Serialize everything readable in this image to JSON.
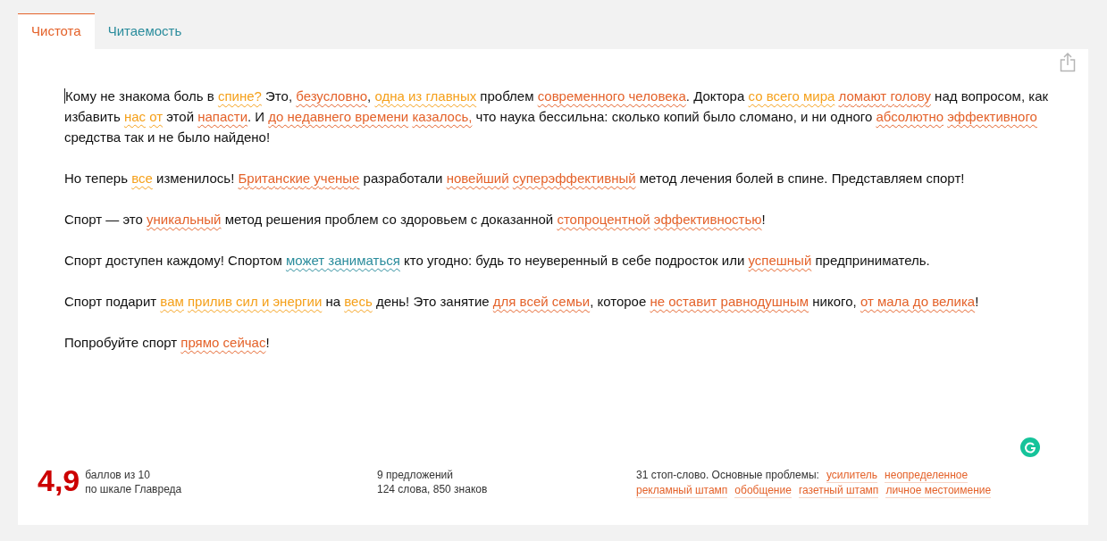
{
  "tabs": [
    {
      "label": "Чистота",
      "selected": true
    },
    {
      "label": "Читаемость",
      "selected": false
    }
  ],
  "editor": {
    "paragraphs": [
      [
        {
          "text": "Кому не знакома боль в "
        },
        {
          "text": "спине?",
          "color": "#f5a01a"
        },
        {
          "text": " Это, "
        },
        {
          "text": "безусловно",
          "color": "#e4622a"
        },
        {
          "text": ", "
        },
        {
          "text": "одна из главных",
          "color": "#f5a01a"
        },
        {
          "text": " проблем "
        },
        {
          "text": "современного человека",
          "color": "#e4622a"
        },
        {
          "text": ". Доктора "
        },
        {
          "text": "со всего мира",
          "color": "#f5a01a",
          "space_after": true
        },
        {
          "text": "ломают голову",
          "color": "#e4622a"
        },
        {
          "text": " над вопросом, как избавить "
        },
        {
          "text": "нас",
          "color": "#f5a01a",
          "space_after": true
        },
        {
          "text": "от",
          "color": "#f5a01a"
        },
        {
          "text": " этой "
        },
        {
          "text": "напасти",
          "color": "#e4622a"
        },
        {
          "text": ". И "
        },
        {
          "text": "до недавнего времени",
          "color": "#e4622a",
          "space_after": true
        },
        {
          "text": "казалось,",
          "color": "#e4622a"
        },
        {
          "text": " что наука бессильна: сколько копий было сломано, и ни одного "
        },
        {
          "text": "абсолютно",
          "color": "#e4622a",
          "space_after": true
        },
        {
          "text": "эффективного",
          "color": "#e4622a"
        },
        {
          "text": " средства так и не было найдено!"
        }
      ],
      [
        {
          "text": "Но теперь "
        },
        {
          "text": "все",
          "color": "#f5a01a"
        },
        {
          "text": " изменилось! "
        },
        {
          "text": "Британские ученые",
          "color": "#e4622a"
        },
        {
          "text": " разработали "
        },
        {
          "text": "новейший",
          "color": "#e4622a",
          "space_after": true
        },
        {
          "text": "суперэффективный",
          "color": "#e4622a"
        },
        {
          "text": " метод лечения болей в спине. Представляем спорт!"
        }
      ],
      [
        {
          "text": "Спорт — это "
        },
        {
          "text": "уникальный",
          "color": "#e4622a"
        },
        {
          "text": " метод решения проблем со здоровьем с доказанной "
        },
        {
          "text": "стопроцентной",
          "color": "#e4622a",
          "space_after": true
        },
        {
          "text": "эффективностью",
          "color": "#e4622a"
        },
        {
          "text": "!"
        }
      ],
      [
        {
          "text": "Спорт доступен каждому! Спортом "
        },
        {
          "text": "может заниматься",
          "color": "#2a8c9c"
        },
        {
          "text": " кто угодно: будь то неуверенный в себе подросток или "
        },
        {
          "text": "успешный",
          "color": "#e4622a"
        },
        {
          "text": " предприниматель."
        }
      ],
      [
        {
          "text": "Спорт подарит "
        },
        {
          "text": "вам",
          "color": "#f5a01a",
          "space_after": true
        },
        {
          "text": "прилив сил и энергии",
          "color": "#f5a01a"
        },
        {
          "text": " на "
        },
        {
          "text": "весь",
          "color": "#f5a01a"
        },
        {
          "text": " день! Это занятие "
        },
        {
          "text": "для всей семьи",
          "color": "#e4622a"
        },
        {
          "text": ", которое "
        },
        {
          "text": "не оставит равнодушным",
          "color": "#e4622a"
        },
        {
          "text": " никого, "
        },
        {
          "text": "от мала до велика",
          "color": "#e4622a"
        },
        {
          "text": "!"
        }
      ],
      [
        {
          "text": "Попробуйте спорт "
        },
        {
          "text": "прямо сейчас",
          "color": "#e4622a"
        },
        {
          "text": "!"
        }
      ]
    ]
  },
  "stats": {
    "score": "4,9",
    "score_lines": [
      "баллов из 10",
      "по шкале Главреда"
    ],
    "count_lines": [
      "9 предложений",
      "124 слова, 850 знаков"
    ],
    "problems_label": "31 стоп-слово. Основные проблемы:",
    "problems": [
      "усилитель",
      "неопределенное",
      "рекламный штамп",
      "обобщение",
      "газетный штамп",
      "личное местоимение"
    ]
  }
}
